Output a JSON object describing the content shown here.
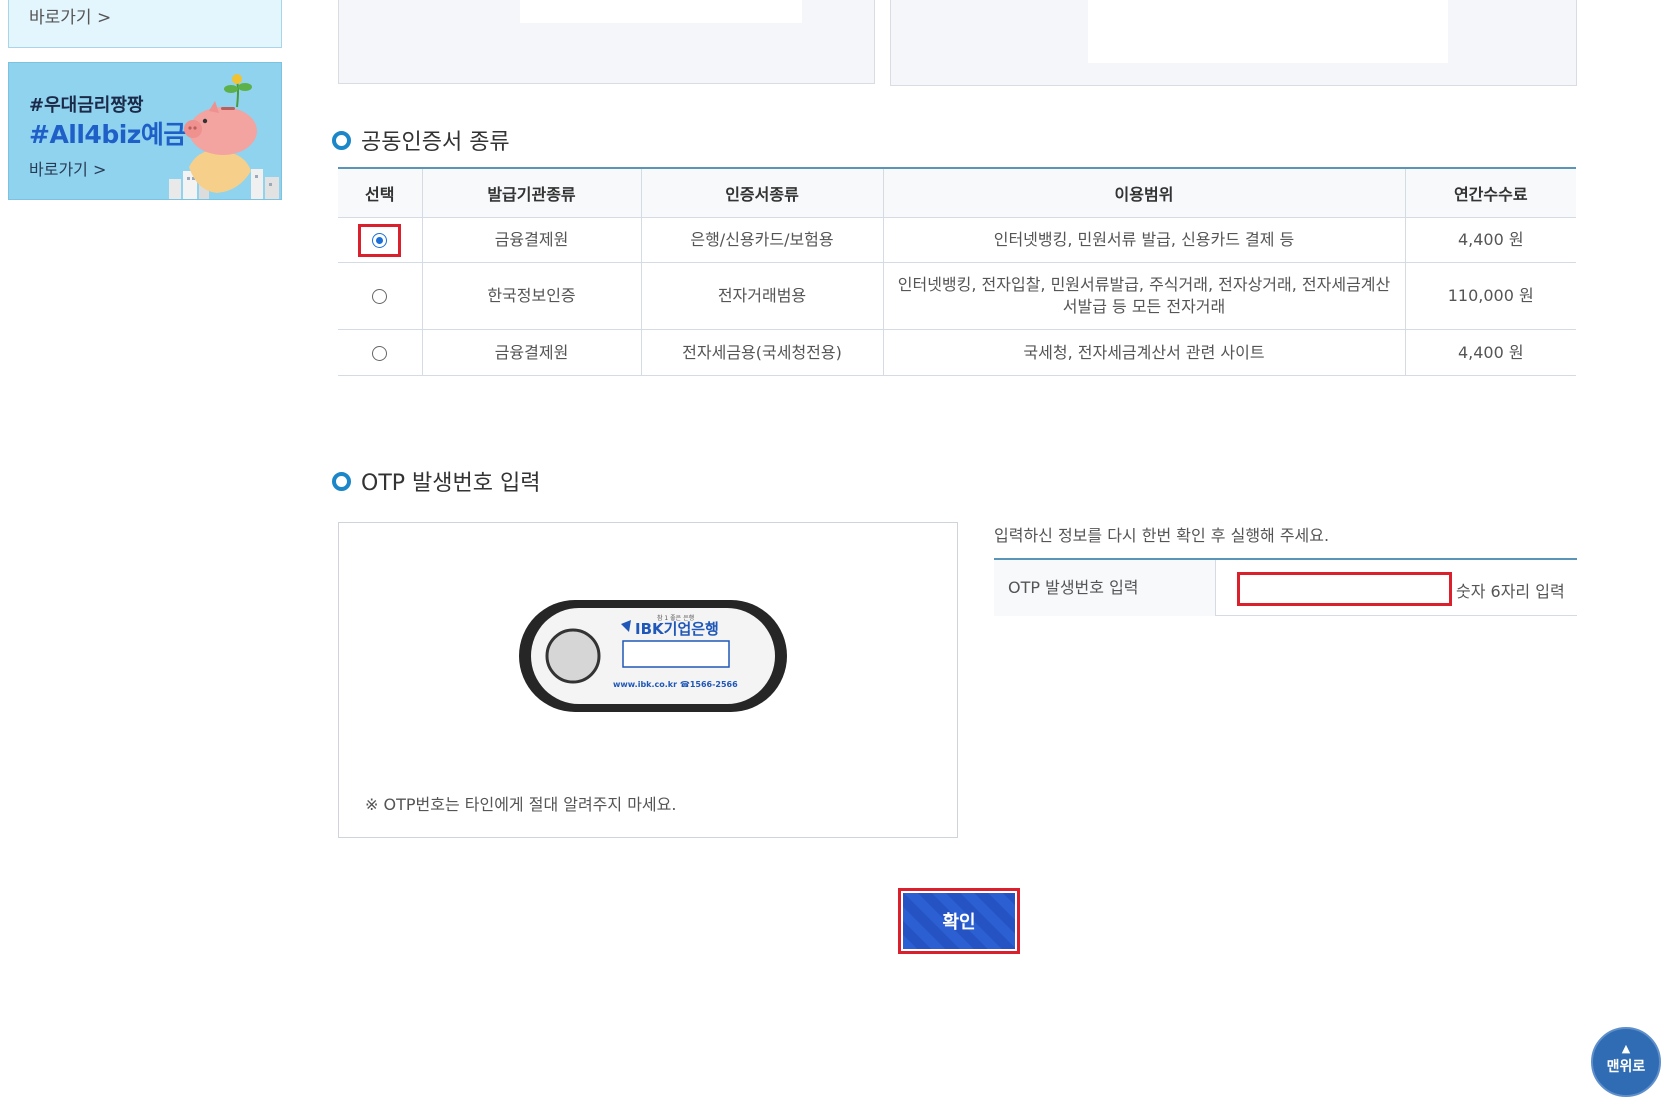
{
  "sidebar": {
    "banner1": {
      "goto_label": "바로가기 >"
    },
    "banner2": {
      "tag1": "#우대금리짱짱",
      "tag2": "#All4biz예금",
      "goto_label": "바로가기 >"
    }
  },
  "cert_section": {
    "title": "공동인증서 종류",
    "headers": [
      "선택",
      "발급기관종류",
      "인증서종류",
      "이용범위",
      "연간수수료"
    ],
    "rows": [
      {
        "selected": true,
        "issuer": "금융결제원",
        "cert_type": "은행/신용카드/보험용",
        "scope": "인터넷뱅킹, 민원서류 발급, 신용카드 결제 등",
        "fee": "4,400 원"
      },
      {
        "selected": false,
        "issuer": "한국정보인증",
        "cert_type": "전자거래범용",
        "scope": "인터넷뱅킹, 전자입찰, 민원서류발급, 주식거래, 전자상거래, 전자세금계산서발급 등 모든 전자거래",
        "fee": "110,000 원"
      },
      {
        "selected": false,
        "issuer": "금융결제원",
        "cert_type": "전자세금용(국세청전용)",
        "scope": "국세청, 전자세금계산서 관련 사이트",
        "fee": "4,400 원"
      }
    ]
  },
  "otp_section": {
    "title": "OTP 발생번호 입력",
    "device": {
      "brand": "IBK기업은행",
      "small": "참 1 좋은 은행",
      "footer": "www.ibk.co.kr ☎1566-2566"
    },
    "note": "※ OTP번호는 타인에게 절대 알려주지 마세요.",
    "info": "입력하신 정보를 다시 한번 확인 후 실행해 주세요.",
    "field_label": "OTP 발생번호 입력",
    "field_value": "",
    "field_hint": "숫자 6자리 입력"
  },
  "confirm_label": "확인",
  "to_top_label": "맨위로",
  "colors": {
    "accent_blue": "#1b86c8",
    "button_blue": "#2b5fd2",
    "highlight_red": "#d9202c"
  }
}
